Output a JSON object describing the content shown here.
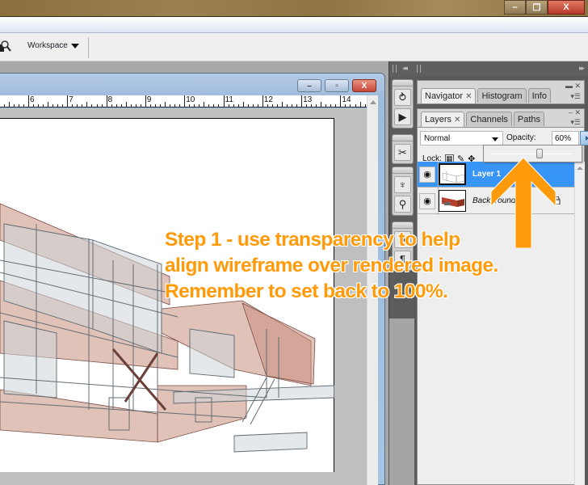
{
  "app": {
    "window_controls": {
      "minimize": "–",
      "restore": "❐",
      "close": "X"
    },
    "options_bar": {
      "tool_icon": "zoom-tool-icon",
      "workspace_label": "Workspace"
    }
  },
  "document": {
    "window_controls": {
      "minimize": "–",
      "restore": "▫",
      "close": "X"
    },
    "ruler_labels": [
      "6",
      "7",
      "8",
      "9",
      "10",
      "11",
      "12",
      "13",
      "14"
    ],
    "canvas_content": "wireframe house render at 60% opacity over rendered image"
  },
  "dock": {
    "collapse_icon": "◂◂",
    "expand_icon": "▸▸",
    "tool_icons": [
      "history-icon",
      "actions-play-icon",
      "tool-presets-icon",
      "brushes-icon",
      "clone-source-icon",
      "character-icon",
      "paragraph-icon"
    ]
  },
  "panels": {
    "navigator_group": {
      "tabs": [
        {
          "label": "Navigator",
          "closable": true,
          "active": true
        },
        {
          "label": "Histogram",
          "closable": false,
          "active": false
        },
        {
          "label": "Info",
          "closable": false,
          "active": false
        }
      ]
    },
    "layers_group": {
      "tabs": [
        {
          "label": "Layers",
          "closable": true,
          "active": true
        },
        {
          "label": "Channels",
          "closable": false,
          "active": false
        },
        {
          "label": "Paths",
          "closable": false,
          "active": false
        }
      ],
      "blend_mode": "Normal",
      "opacity_label": "Opacity:",
      "opacity_value": "60%",
      "opacity_fraction": 0.6,
      "lock_label": "Lock:",
      "layers": [
        {
          "name": "Layer 1",
          "visible": true,
          "selected": true,
          "locked": false
        },
        {
          "name": "Background",
          "visible": true,
          "selected": false,
          "locked": true
        }
      ]
    }
  },
  "annotation": {
    "lines": [
      "Step 1 - use transparency to help",
      "align wireframe over rendered image.",
      "Remember to set back to 100%."
    ],
    "color": "#ff9a0a"
  }
}
